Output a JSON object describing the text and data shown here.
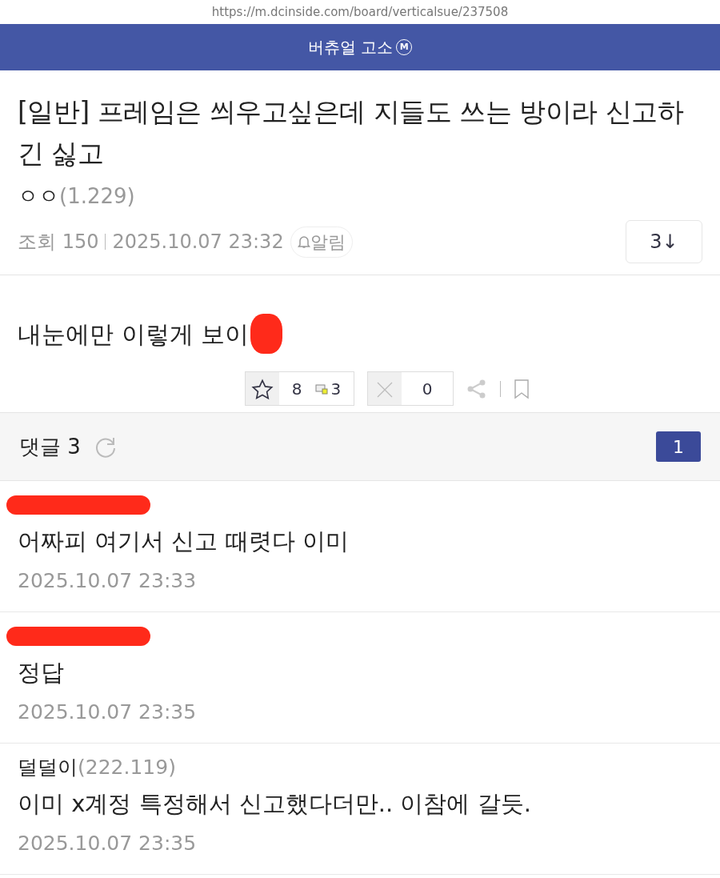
{
  "address_bar": {
    "url": "https://m.dcinside.com/board/verticalsue/237508"
  },
  "header": {
    "title": "버츄얼 고소",
    "badge": "M"
  },
  "post": {
    "title": "[일반] 프레임은 씌우고싶은데 지들도 쓰는 방이라 신고하긴 싫고",
    "author": "ㅇㅇ",
    "author_ip": "(1.229)",
    "views_label": "조회",
    "views": "150",
    "date": "2025.10.07 23:32",
    "alert_label": "알림",
    "comment_jump": "3↓",
    "body": "내눈에만 이렇게 보이",
    "body_redacted": true,
    "actions": {
      "recommend": "8",
      "fixed_recommend": "3",
      "downvote": "0"
    }
  },
  "comments_header": {
    "label": "댓글 3",
    "page": "1"
  },
  "comments": [
    {
      "kind": "redacted",
      "text": "어짜피 여기서 신고 때렷다 이미",
      "date": "2025.10.07 23:33"
    },
    {
      "kind": "redacted",
      "text": "정답",
      "date": "2025.10.07 23:35"
    },
    {
      "kind": "named",
      "author": "덜덜이",
      "author_ip": "(222.119)",
      "text": "이미 x계정 특정해서 신고했다더만.. 이참에 갈듯.",
      "date": "2025.10.07 23:35"
    }
  ]
}
